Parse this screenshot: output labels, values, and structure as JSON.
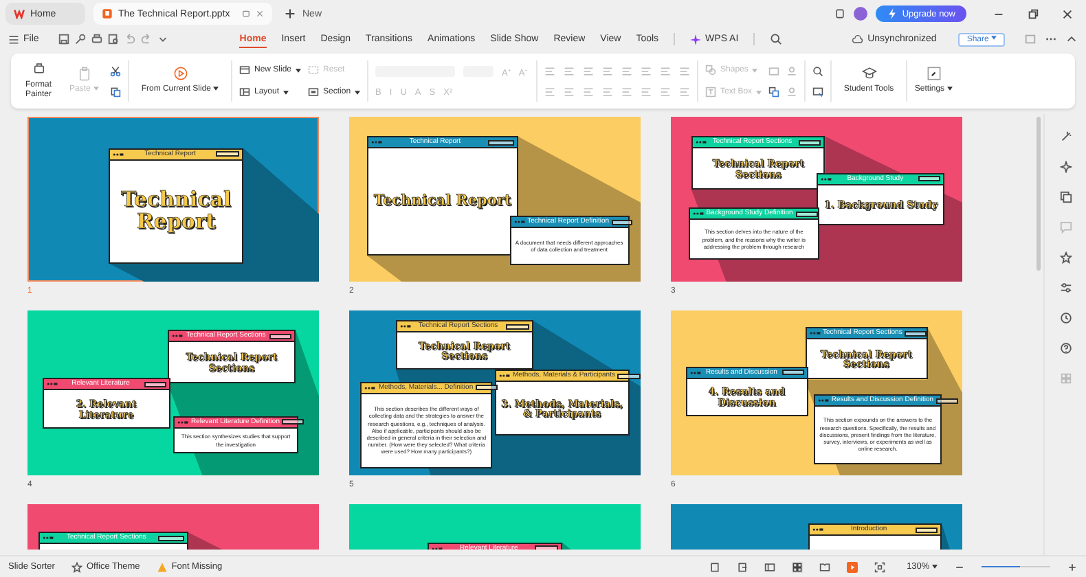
{
  "app_tabs": [
    {
      "label": "Home",
      "kind": "home",
      "selected": false
    },
    {
      "label": "The Technical Report.pptx",
      "kind": "doc",
      "selected": true
    }
  ],
  "new_tab": "New",
  "upgrade_button": "Upgrade now",
  "menu": {
    "file": "File",
    "ai": "WPS AI",
    "sync": "Unsynchronized",
    "share": "Share",
    "tabs": [
      {
        "label": "Home",
        "selected": true
      },
      {
        "label": "Insert",
        "selected": false
      },
      {
        "label": "Design",
        "selected": false
      },
      {
        "label": "Transitions",
        "selected": false
      },
      {
        "label": "Animations",
        "selected": false
      },
      {
        "label": "Slide Show",
        "selected": false
      },
      {
        "label": "Review",
        "selected": false
      },
      {
        "label": "View",
        "selected": false
      },
      {
        "label": "Tools",
        "selected": false
      }
    ]
  },
  "ribbon": {
    "format_painter": "Format Painter",
    "paste": "Paste",
    "from_current": "From Current Slide",
    "new_slide": "New Slide",
    "reset": "Reset",
    "layout": "Layout",
    "section": "Section",
    "font_size_buttons": [
      "A⁺",
      "A⁻"
    ],
    "format_buttons": [
      "B",
      "I",
      "U",
      "A",
      "S",
      "X²"
    ],
    "shapes": "Shapes",
    "text_box": "Text Box",
    "student_tools": "Student Tools",
    "settings": "Settings"
  },
  "slides": [
    {
      "number": "1",
      "selected": true,
      "color": "#1089b5",
      "windows": [
        {
          "kind": "heading",
          "title": "Technical Report",
          "color": "#f6c94f",
          "text": "Technical Report"
        }
      ]
    },
    {
      "number": "2",
      "selected": false,
      "color": "#fbcd62",
      "windows": [
        {
          "kind": "heading",
          "title": "Technical Report",
          "color": "#1a8fb5",
          "text": "Technical Report"
        },
        {
          "kind": "paragraph",
          "title": "Technical Report Definition",
          "color": "#1a8fb5",
          "text": "A document that needs different approaches of data collection and treatment"
        }
      ]
    },
    {
      "number": "3",
      "selected": false,
      "color": "#f04a70",
      "windows": [
        {
          "kind": "heading",
          "title": "Technical Report Sections",
          "color": "#0ed3a0",
          "text": "Technical Report Sections"
        },
        {
          "kind": "heading",
          "title": "Background Study",
          "color": "#0ed3a0",
          "text": "1. Background Study"
        },
        {
          "kind": "paragraph",
          "title": "Background Study Definition",
          "color": "#0ed3a0",
          "text": "This section delves into the nature of the problem, and the reasons why the writer is addressing the problem through research"
        }
      ]
    },
    {
      "number": "4",
      "selected": false,
      "color": "#06d6a0",
      "windows": [
        {
          "kind": "heading",
          "title": "Technical Report Sections",
          "color": "#f04a70",
          "text": "Technical Report Sections"
        },
        {
          "kind": "heading",
          "title": "Relevant Literature",
          "color": "#f04a70",
          "text": "2. Relevant Literature"
        },
        {
          "kind": "paragraph",
          "title": "Relevant Literature Definition",
          "color": "#f04a70",
          "text": "This section synthesizes studies that support the investigation"
        }
      ]
    },
    {
      "number": "5",
      "selected": false,
      "color": "#1089b5",
      "windows": [
        {
          "kind": "heading",
          "title": "Technical Report Sections",
          "color": "#f6c94f",
          "text": "Technical Report Sections"
        },
        {
          "kind": "heading",
          "title": "Methods, Materials & Participants",
          "color": "#f6c94f",
          "text": "3. Methods, Materials, & Participants"
        },
        {
          "kind": "paragraph",
          "title": "Methods, Materials... Definition",
          "color": "#f6c94f",
          "text": "This section describes the different ways of collecting data and the strategies to answer the research questions, e.g., techniques of analysis. Also if applicable, participants should also be described in general criteria in their selection and number. (How were they selected? What criteria were used? How many participants?)"
        }
      ]
    },
    {
      "number": "6",
      "selected": false,
      "color": "#fbcd62",
      "windows": [
        {
          "kind": "heading",
          "title": "Technical Report Sections",
          "color": "#1a8fb5",
          "text": "Technical Report Sections"
        },
        {
          "kind": "heading",
          "title": "Results and Discussion",
          "color": "#1a8fb5",
          "text": "4. Results and Discussion"
        },
        {
          "kind": "paragraph",
          "title": "Results and Discussion Definition",
          "color": "#1a8fb5",
          "text": "This section expounds on the answers to the research questions. Specifically, the results and discussions, present findings from the literature, survey, interviews, or experiments as well as online research."
        }
      ]
    },
    {
      "selected": false,
      "color": "#f04a70",
      "windows": [
        {
          "kind": "heading",
          "title": "Technical Report Sections",
          "color": "#0ed3a0"
        }
      ]
    },
    {
      "selected": false,
      "color": "#06d6a0",
      "windows": [
        {
          "kind": "heading",
          "title": "Relevant Literature",
          "color": "#f04a70"
        }
      ]
    },
    {
      "selected": false,
      "color": "#1089b5",
      "windows": [
        {
          "kind": "heading",
          "title": "Introduction",
          "color": "#f6c94f"
        }
      ]
    }
  ],
  "status": {
    "items": [
      "Slide Sorter",
      "Office Theme",
      "Font Missing"
    ],
    "zoom": "130%",
    "level": 0.55
  }
}
